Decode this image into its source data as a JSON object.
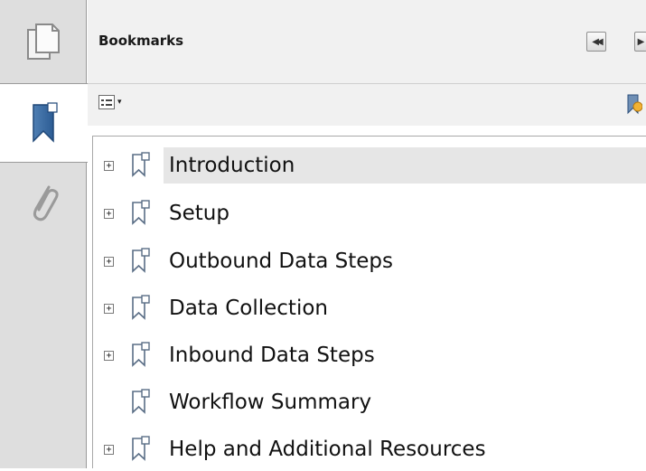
{
  "panel": {
    "title": "Bookmarks",
    "nav_prev": "◀◀",
    "nav_next": "▶"
  },
  "side_tabs": [
    {
      "name": "pages",
      "icon": "pages-icon"
    },
    {
      "name": "bookmarks",
      "icon": "bookmark-icon",
      "active": true
    },
    {
      "name": "attachments",
      "icon": "paperclip-icon"
    }
  ],
  "toolbar": {
    "options_icon": "list-options-icon",
    "options_caret": "▾",
    "new_bookmark_icon": "new-bookmark-icon"
  },
  "bookmarks": [
    {
      "label": "Introduction",
      "expandable": true,
      "selected": true
    },
    {
      "label": "Setup",
      "expandable": true
    },
    {
      "label": "Outbound Data Steps",
      "expandable": true
    },
    {
      "label": "Data Collection",
      "expandable": true
    },
    {
      "label": "Inbound Data Steps",
      "expandable": true
    },
    {
      "label": "Workflow Summary",
      "expandable": false
    },
    {
      "label": "Help and Additional Resources",
      "expandable": true
    }
  ],
  "expander_symbol": "+",
  "colors": {
    "tab_strip": "#dedede",
    "header_bg": "#f1f1f1",
    "selected_row": "#e6e6e6"
  }
}
